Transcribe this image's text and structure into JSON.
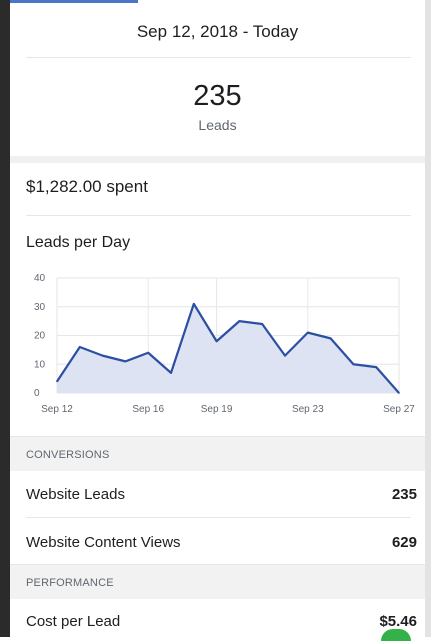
{
  "header": {
    "date_range": "Sep 12, 2018 - Today"
  },
  "summary": {
    "leads_value": "235",
    "leads_label": "Leads",
    "spent": "$1,282.00 spent"
  },
  "chart_data": {
    "type": "area",
    "title": "Leads per Day",
    "x": [
      "Sep 12",
      "Sep 13",
      "Sep 14",
      "Sep 15",
      "Sep 16",
      "Sep 17",
      "Sep 18",
      "Sep 19",
      "Sep 20",
      "Sep 21",
      "Sep 22",
      "Sep 23",
      "Sep 24",
      "Sep 25",
      "Sep 26",
      "Sep 27"
    ],
    "values": [
      4,
      16,
      13,
      11,
      14,
      7,
      31,
      18,
      25,
      24,
      13,
      21,
      19,
      10,
      9,
      0
    ],
    "x_tick_labels": [
      "Sep 12",
      "Sep 16",
      "Sep 19",
      "Sep 23",
      "Sep 27"
    ],
    "y_ticks": [
      0,
      10,
      20,
      30,
      40
    ],
    "ylim": [
      0,
      40
    ],
    "grid": true,
    "line_color": "#2c4fa3",
    "fill_color": "#dde3f3"
  },
  "conversions": {
    "header": "CONVERSIONS",
    "rows": [
      {
        "label": "Website Leads",
        "value": "235"
      },
      {
        "label": "Website Content Views",
        "value": "629"
      }
    ]
  },
  "performance": {
    "header": "PERFORMANCE",
    "rows": [
      {
        "label": "Cost per Lead",
        "value": "$5.46"
      }
    ]
  },
  "colors": {
    "accent": "#4a76c9",
    "status_green": "#33b249"
  }
}
